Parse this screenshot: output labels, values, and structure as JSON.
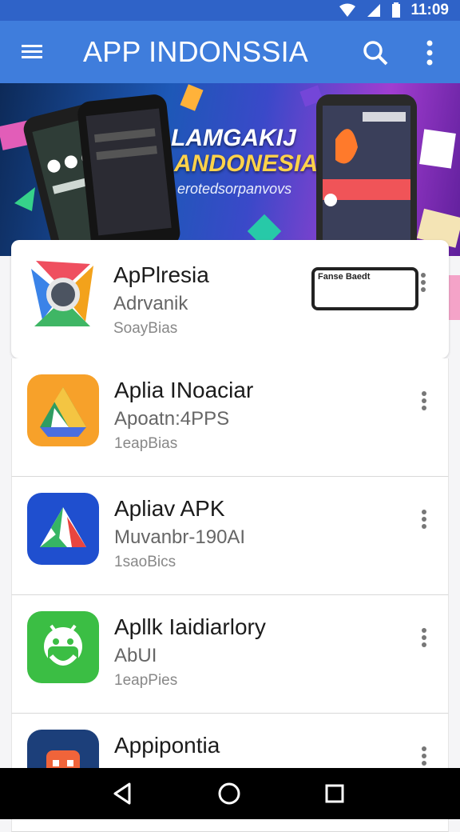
{
  "status_bar": {
    "time": "11:09",
    "icons": [
      "wifi-icon",
      "signal-icon",
      "battery-icon"
    ]
  },
  "app_bar": {
    "title": "APP INDONSSIA",
    "icons": [
      "menu-icon",
      "search-icon",
      "more-vert-icon"
    ]
  },
  "banner": {
    "line1": "LAMGAKIJ",
    "line2": "ANDONESIA",
    "line3": "erotedsorpanvovs"
  },
  "apps": [
    {
      "name": "ApPlresia",
      "subtitle": "Adrvanik",
      "meta": "SoayBias",
      "icon": "multicolor-app-icon",
      "thumb_caption": "Fanse Baedt"
    },
    {
      "name": "Aplia INoaciar",
      "subtitle": "Apoatn:4PPS",
      "meta": "1eapBias",
      "icon": "drive-triangle-icon"
    },
    {
      "name": "Apliav APK",
      "subtitle": "Muvanbr-190AI",
      "meta": "1saoBics",
      "icon": "drive-triangle-blue-icon"
    },
    {
      "name": "Apllk Iaidiarlory",
      "subtitle": "AbUI",
      "meta": "1eapPies",
      "icon": "android-icon"
    },
    {
      "name": "Appipontia",
      "subtitle": "",
      "meta": "",
      "icon": "robot-app-icon"
    }
  ],
  "colors": {
    "app_bar": "#3f7ddc",
    "status_bar": "#2f63c8",
    "nav_bar": "#000000"
  },
  "nav_bar": {
    "buttons": [
      "back-icon",
      "home-icon",
      "recents-icon"
    ]
  }
}
